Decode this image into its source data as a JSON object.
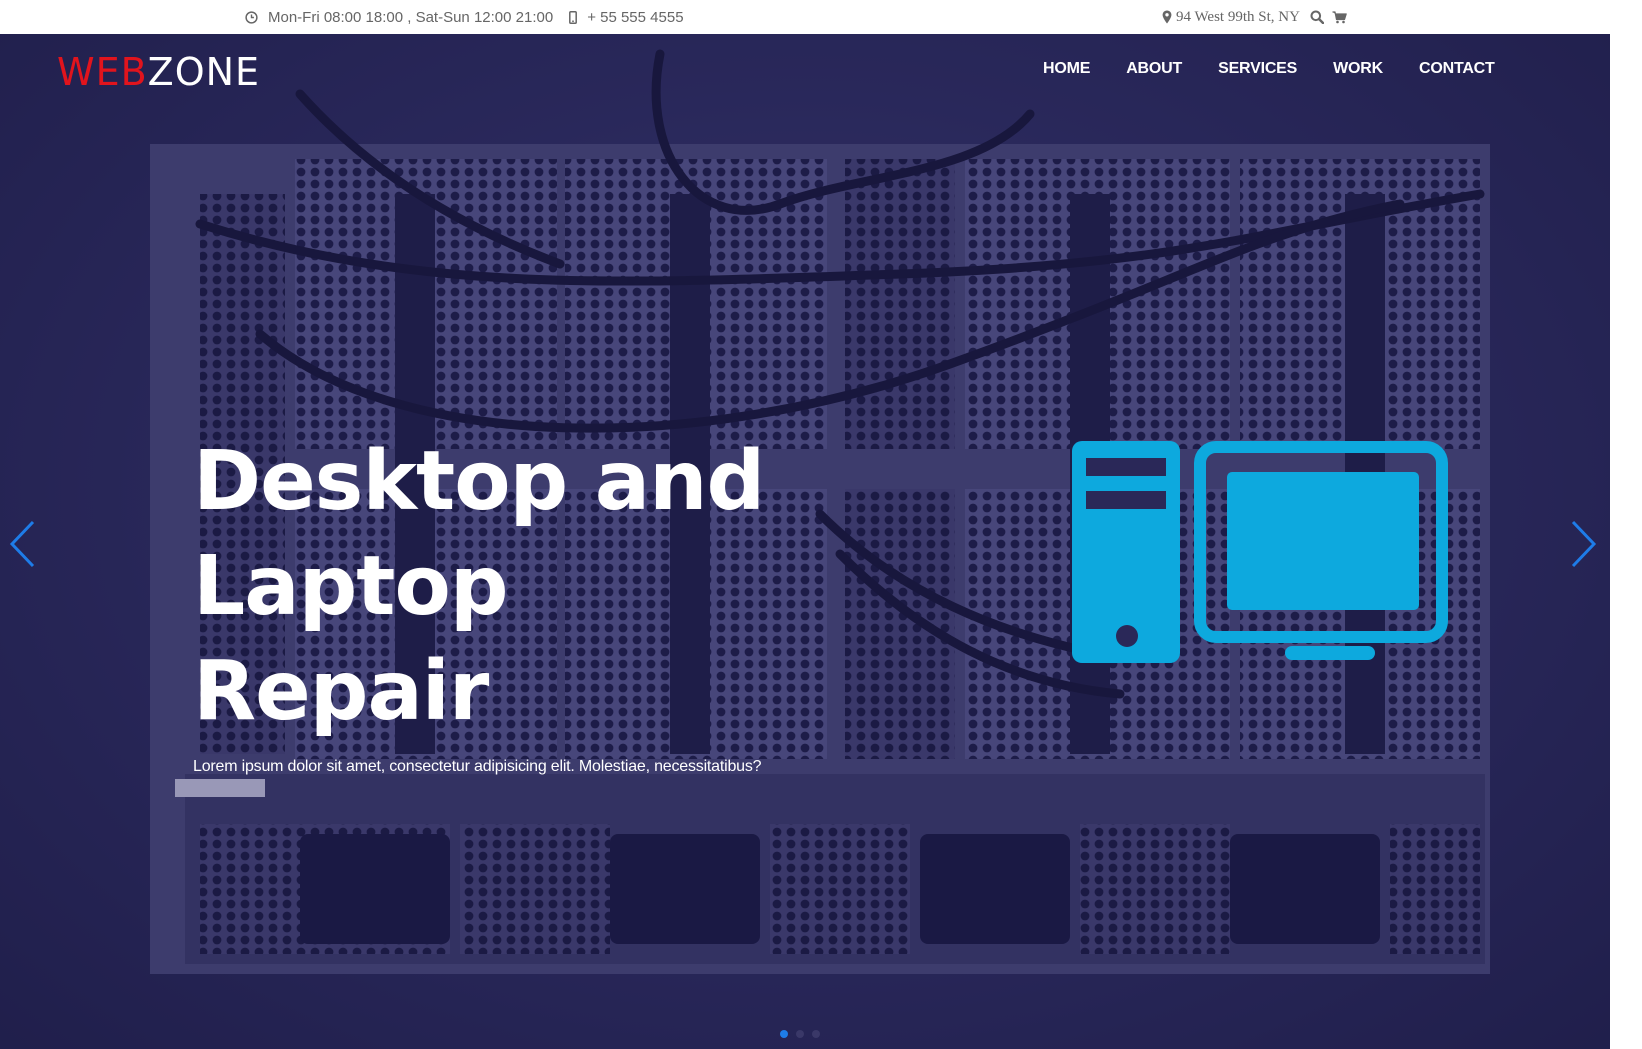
{
  "topbar": {
    "hours": "Mon-Fri 08:00 18:00 , Sat-Sun 12:00 21:00",
    "phone": "+ 55 555 4555",
    "address": "94 West 99th St, NY",
    "icons": [
      "clock-icon",
      "mobile-phone-icon",
      "map-marker-icon",
      "search-icon",
      "shopping-cart-icon"
    ]
  },
  "brand": {
    "logo_accent": "WEB",
    "logo_rest": "ZONE",
    "accent_color": "#e1141d"
  },
  "nav": {
    "items": [
      "HOME",
      "ABOUT",
      "SERVICES",
      "WORK",
      "CONTACT"
    ]
  },
  "hero": {
    "title_line1": "Desktop and Laptop",
    "title_line2": "Repair",
    "subtitle": "Lorem ipsum dolor sit amet, consectetur adipisicing elit. Molestiae, necessitatibus?",
    "illustration": "desktop-computer-icon",
    "illustration_color": "#0da9de",
    "slides_count": 3,
    "active_slide": 1,
    "arrow_color": "#1e7ce8"
  }
}
